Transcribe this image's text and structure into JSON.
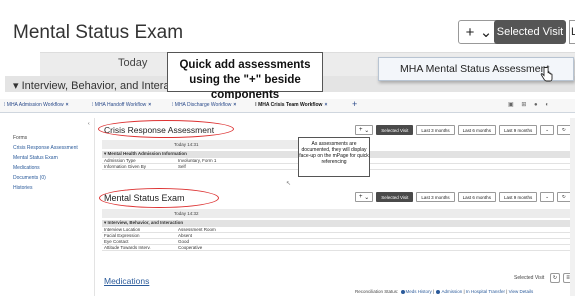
{
  "zoom": {
    "title": "Mental Status Exam",
    "plus_label": "+",
    "dropdown_glyph": "⌄",
    "selected_visit": "Selected Visit",
    "cut_button": "L",
    "today_label": "Today",
    "section_label": "Interview, Behavior, and Intera",
    "section_caret": "▾"
  },
  "callout": "Quick add assessments using the \"+\" beside components",
  "popup": {
    "label": "MHA Mental Status Assessment",
    "cursor_icon": "hand-pointer-icon"
  },
  "tabs": [
    {
      "label": "MHA Admission Workflow",
      "close": "×"
    },
    {
      "label": "MHA Handoff Workflow",
      "close": "×"
    },
    {
      "label": "MHA Discharge Workflow",
      "close": "×"
    },
    {
      "label": "MHA Crisis Team Workflow",
      "close": "×"
    }
  ],
  "tab_add": "+",
  "tab_right_icons": "▣ ⊞ ● ◐",
  "nav": {
    "collapse": "‹",
    "items": [
      "Forms",
      "Crisis Response Assessment",
      "Mental Status Exam",
      "Medications",
      "Documents (0)",
      "Histories"
    ]
  },
  "crisis": {
    "title": "Crisis Response Assessment",
    "today": "Today 14:31",
    "section": "Mental Health Admission Information",
    "rows": [
      {
        "k": "Admission Type",
        "v": "Involuntary, Form 1"
      },
      {
        "k": "Information Given By",
        "v": "Self"
      }
    ]
  },
  "mse": {
    "title": "Mental Status Exam",
    "today": "Today 14:32",
    "section": "Interview, Behavior, and Interaction",
    "rows": [
      {
        "k": "Interview Location",
        "v": "Assessment Room"
      },
      {
        "k": "Facial Expression",
        "v": "Absent"
      },
      {
        "k": "Eye Contact",
        "v": "Good"
      },
      {
        "k": "Attitude Towards Interv.",
        "v": "Cooperative"
      }
    ]
  },
  "toolbar": {
    "plus": "+",
    "dropdown": "⌄",
    "selected_visit": "Selected Visit",
    "last3": "Last 3 months",
    "last6": "Last 6 months",
    "last9": "Last 9 months",
    "more": "⌄",
    "refresh": "↻"
  },
  "note": "As assessments are documented, they will display face-up on the mPage for quick referencing",
  "medications": {
    "title": "Medications",
    "selected_visit": "Selected Visit",
    "icon1": "↻",
    "icon2": "≡"
  },
  "reconciliation": {
    "label": "Reconciliation Status:",
    "meds_history": "Meds History",
    "admission": "Admission",
    "transfer": "In Hospital Transfer",
    "view_details": "View Details"
  },
  "colors": {
    "accent_link": "#2a5a9a",
    "oval": "#dd3333",
    "dark_button": "#4a4a4a"
  }
}
